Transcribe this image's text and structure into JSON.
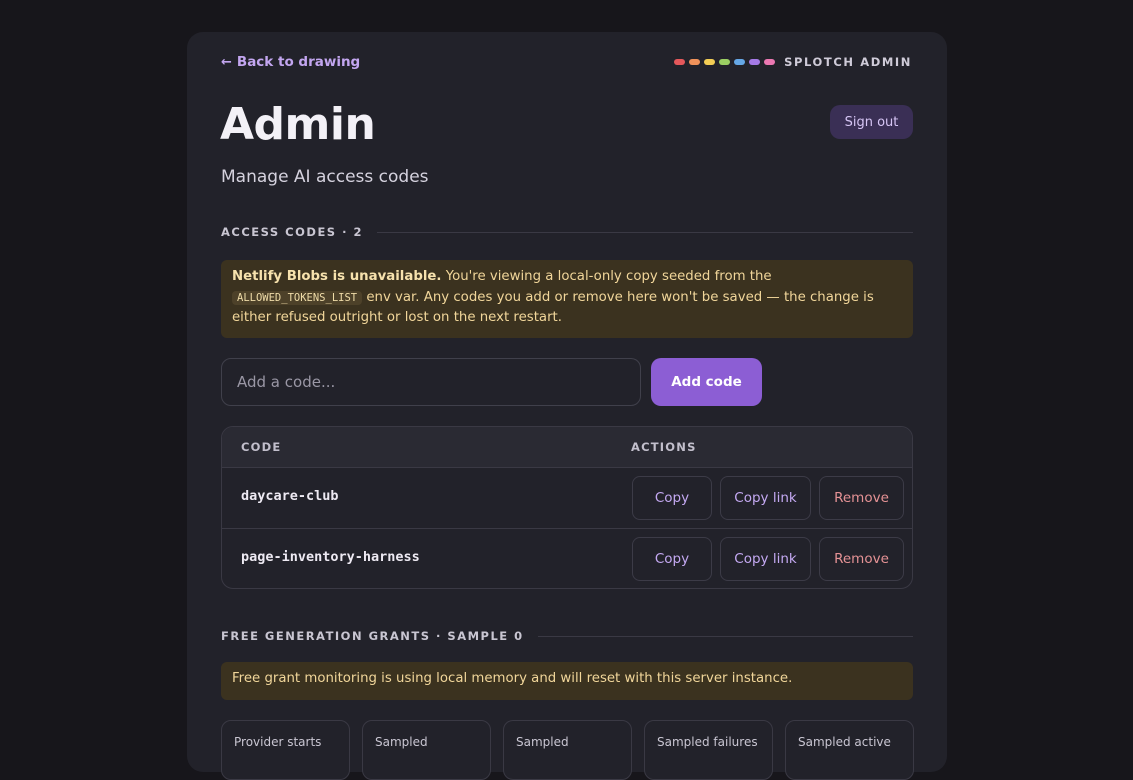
{
  "nav": {
    "back_label": "Back to drawing",
    "back_icon": "arrow-left-icon",
    "brand": "SPLOTCH ADMIN",
    "brand_dots": [
      "#e5585b",
      "#f0925a",
      "#f3cd55",
      "#9bcf63",
      "#65a7e6",
      "#a57ae6",
      "#ec78b2"
    ]
  },
  "header": {
    "title": "Admin",
    "subtitle": "Manage AI access codes",
    "sign_out_label": "Sign out"
  },
  "access_codes": {
    "section_label": "ACCESS CODES · 2",
    "warning": {
      "bold": "Netlify Blobs is unavailable.",
      "text_before_code": " You're viewing a local-only copy seeded from the ",
      "code": "ALLOWED_TOKENS_LIST",
      "text_after_code": " env var. Any codes you add or remove here won't be saved — the change is either refused outright or lost on the next restart."
    },
    "input_placeholder": "Add a code...",
    "input_value": "",
    "add_button_label": "Add code",
    "table": {
      "headers": [
        "CODE",
        "ACTIONS"
      ],
      "rows": [
        {
          "code": "daycare-club",
          "copy": "Copy",
          "copy_link": "Copy link",
          "remove": "Remove"
        },
        {
          "code": "page-inventory-harness",
          "copy": "Copy",
          "copy_link": "Copy link",
          "remove": "Remove"
        }
      ]
    }
  },
  "grants": {
    "section_label": "FREE GENERATION GRANTS · SAMPLE 0",
    "notice": "Free grant monitoring is using local memory and will reset with this server instance.",
    "stat_cards": [
      "Provider starts",
      "Sampled",
      "Sampled",
      "Sampled failures",
      "Sampled active"
    ]
  },
  "colors": {
    "accent": "#8c5ed4",
    "warning_bg": "#3b321f",
    "remove_text": "#e59295"
  }
}
